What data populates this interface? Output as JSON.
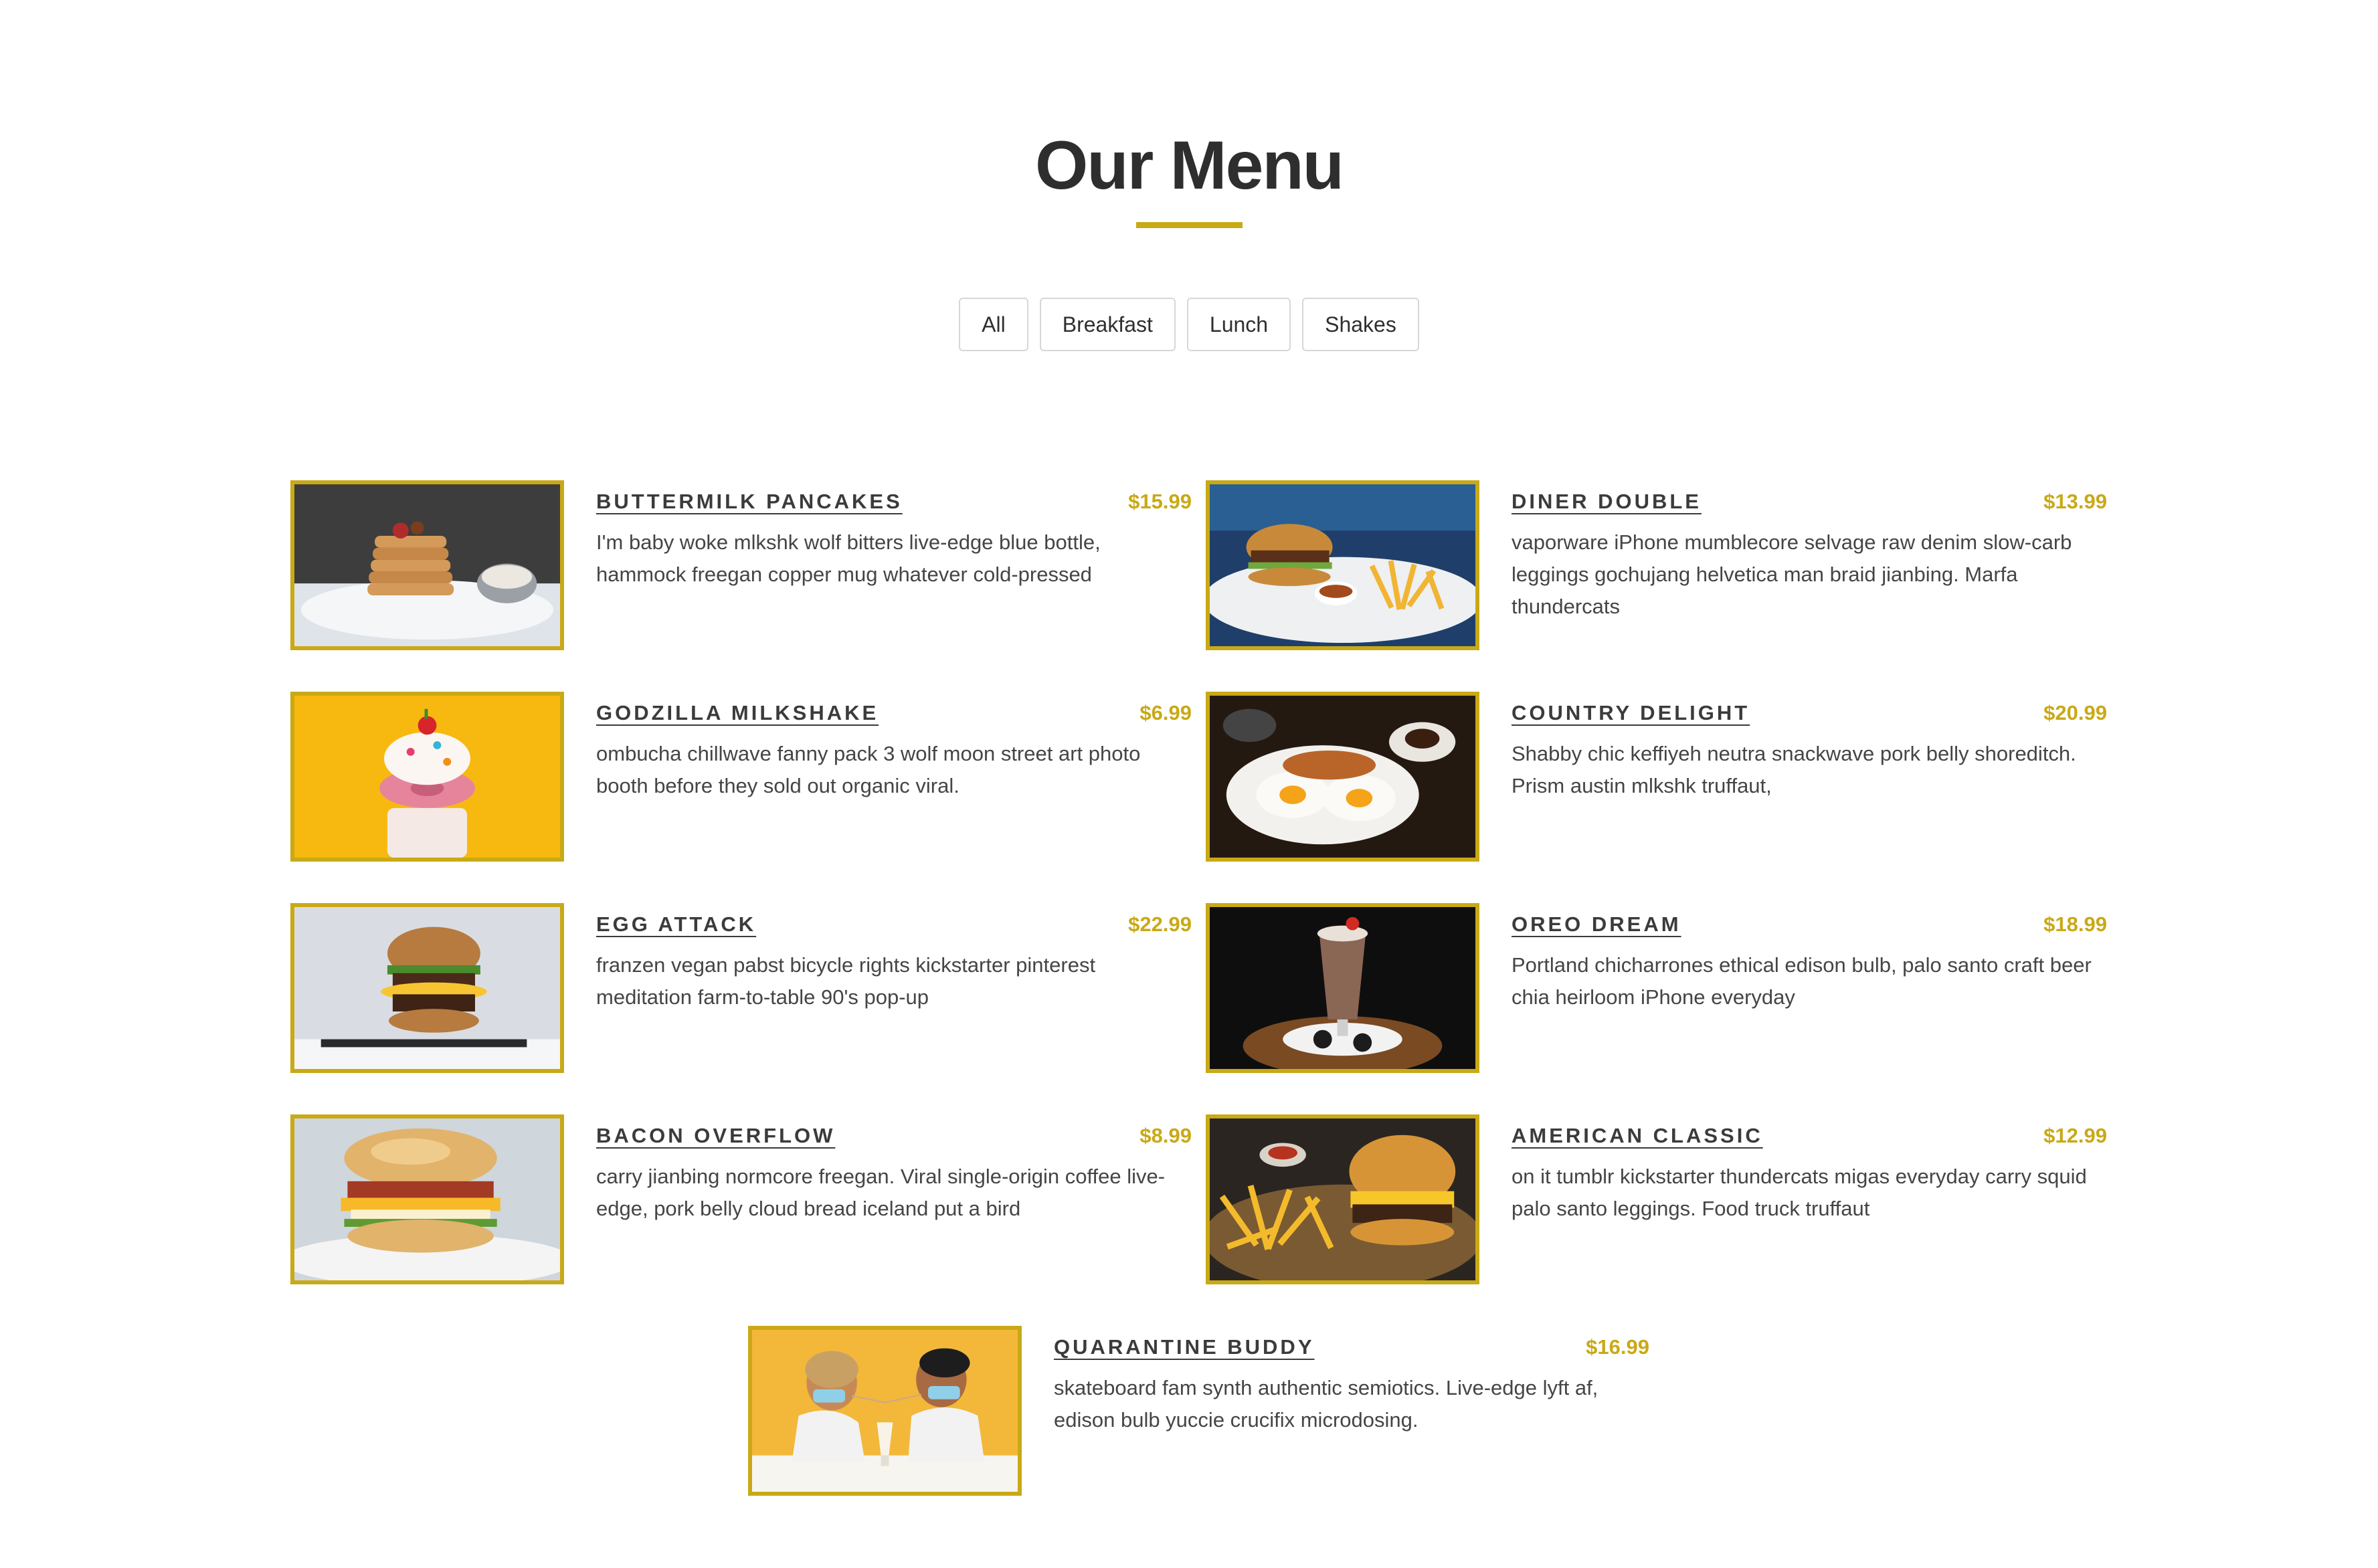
{
  "page": {
    "title": "Our Menu",
    "accent_color": "#c9a916"
  },
  "filters": [
    "All",
    "Breakfast",
    "Lunch",
    "Shakes"
  ],
  "menu_items": [
    {
      "name": "Buttermilk Pancakes",
      "price": "$15.99",
      "description": "I'm baby woke mlkshk wolf bitters live-edge blue bottle, hammock freegan copper mug whatever cold-pressed",
      "image_icon": "pancakes-image"
    },
    {
      "name": "Diner Double",
      "price": "$13.99",
      "description": "vaporware iPhone mumblecore selvage raw denim slow-carb leggings gochujang helvetica man braid jianbing. Marfa thundercats",
      "image_icon": "burger-fries-image"
    },
    {
      "name": "Godzilla Milkshake",
      "price": "$6.99",
      "description": "ombucha chillwave fanny pack 3 wolf moon street art photo booth before they sold out organic viral.",
      "image_icon": "milkshake-image"
    },
    {
      "name": "Country Delight",
      "price": "$20.99",
      "description": "Shabby chic keffiyeh neutra snackwave pork belly shoreditch. Prism austin mlkshk truffaut,",
      "image_icon": "breakfast-plate-image"
    },
    {
      "name": "Egg Attack",
      "price": "$22.99",
      "description": "franzen vegan pabst bicycle rights kickstarter pinterest meditation farm-to-table 90's pop-up",
      "image_icon": "egg-burger-image"
    },
    {
      "name": "Oreo Dream",
      "price": "$18.99",
      "description": "Portland chicharrones ethical edison bulb, palo santo craft beer chia heirloom iPhone everyday",
      "image_icon": "oreo-shake-image"
    },
    {
      "name": "Bacon Overflow",
      "price": "$8.99",
      "description": "carry jianbing normcore freegan. Viral single-origin coffee live-edge, pork belly cloud bread iceland put a bird",
      "image_icon": "bacon-biscuit-image"
    },
    {
      "name": "American Classic",
      "price": "$12.99",
      "description": "on it tumblr kickstarter thundercats migas everyday carry squid palo santo leggings. Food truck truffaut",
      "image_icon": "classic-burger-image"
    },
    {
      "name": "Quarantine Buddy",
      "price": "$16.99",
      "description": "skateboard fam synth authentic semiotics. Live-edge lyft af, edison bulb yuccie crucifix microdosing.",
      "image_icon": "couple-shake-image"
    }
  ]
}
